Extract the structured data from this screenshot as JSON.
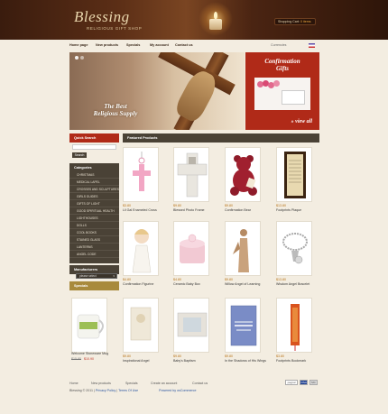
{
  "header": {
    "logo": "Blessing",
    "tagline": "RELIGIOUS GIFT SHOP",
    "cart_label": "Shopping Cart",
    "cart_items": "0 items",
    "icons": [
      "candle-icon",
      "flag-icon"
    ]
  },
  "nav": [
    "Home page",
    "New products",
    "Specials",
    "My account",
    "Contact us"
  ],
  "currency": "Currencies",
  "banner": {
    "text_line1": "The Best",
    "text_line2": "Religious Supply"
  },
  "promo": {
    "title_line1": "Confirmation",
    "title_line2": "Gifts",
    "link": "» view all"
  },
  "sidebar": {
    "search_title": "Quick Search",
    "search_button": "Search",
    "categories_title": "Categories",
    "categories": [
      "CHRISTMAS",
      "MEDICAL LAPEL",
      "CROSSES AND SCULPTURES",
      "GIRLS GUIDES",
      "GIFTS OF LIGHT",
      "GOOD SPIRITUAL HEALTH",
      "LIGHTHOUSES",
      "DOLLS",
      "COOL BOOKS",
      "STAINED GLASS",
      "LANTERNS",
      "ANGEL CODE"
    ],
    "manufacturers_title": "Manufacturers",
    "manufacturers_select": "please select",
    "specials_title": "Specials"
  },
  "featured_title": "Featured Products",
  "products": [
    {
      "price": "$3.80",
      "name": "Lil Gal Enameled Cross"
    },
    {
      "price": "$9.80",
      "name": "Blessed Photo Frame"
    },
    {
      "price": "$9.80",
      "name": "Confirmation Bear"
    },
    {
      "price": "$13.80",
      "name": "Footprints Plaque"
    },
    {
      "price": "$4.80",
      "name": "Confirmation Figurine"
    },
    {
      "price": "$4.80",
      "name": "Ceramic Baby Box"
    },
    {
      "price": "$9.80",
      "name": "Willow Angel of Learning"
    },
    {
      "price": "$13.80",
      "name": "Wisdom Angel Bracelet"
    },
    {
      "old_price": "$15.80",
      "price": "$10.90",
      "name": "Welcome Stoneware Mug"
    },
    {
      "price": "$9.80",
      "name": "Inspirational Angel"
    },
    {
      "price": "$9.80",
      "name": "Baby's Baptism"
    },
    {
      "price": "$9.80",
      "name": "In the Shadows of His Wings"
    },
    {
      "price": "$3.80",
      "name": "Footprints Bookmark"
    }
  ],
  "footer": {
    "links": [
      "Home",
      "New products",
      "Specials",
      "Create an account",
      "Contact us"
    ],
    "copyright": "Blessing © 2011",
    "privacy": "Privacy Policy",
    "terms": "Terms Of Use",
    "powered": "Powered by osCommerce",
    "payments": [
      "paypal",
      "VISA",
      "MC"
    ]
  }
}
